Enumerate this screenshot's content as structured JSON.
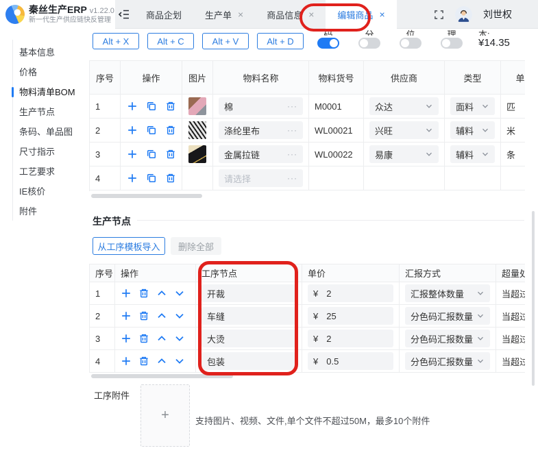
{
  "colors": {
    "accent_blue": "#1f7bf4",
    "annotation_red": "#e0211c"
  },
  "header": {
    "brand": {
      "name": "秦丝生产ERP",
      "version": "v1.22.0",
      "subtitle": "新一代生产供应链快反管理"
    },
    "tabs": [
      {
        "key": "product-planning",
        "label": "商品企划",
        "closable": false,
        "active": false
      },
      {
        "key": "production-order",
        "label": "生产单",
        "closable": true,
        "active": false
      },
      {
        "key": "product-info",
        "label": "商品信息",
        "closable": true,
        "active": false
      },
      {
        "key": "edit-product",
        "label": "编辑商品",
        "closable": true,
        "active": true
      }
    ],
    "user": {
      "name": "刘世权"
    }
  },
  "sidebar": {
    "items": [
      {
        "key": "basic-info",
        "label": "基本信息",
        "active": false
      },
      {
        "key": "price",
        "label": "价格",
        "active": false
      },
      {
        "key": "bom",
        "label": "物料清单BOM",
        "active": true
      },
      {
        "key": "production-node",
        "label": "生产节点",
        "active": false
      },
      {
        "key": "barcode-item-images",
        "label": "条码、单品图",
        "active": false
      },
      {
        "key": "size-guide",
        "label": "尺寸指示",
        "active": false
      },
      {
        "key": "craft-requirements",
        "label": "工艺要求",
        "active": false
      },
      {
        "key": "ie-costing",
        "label": "IE核价",
        "active": false
      },
      {
        "key": "attachments",
        "label": "附件",
        "active": false
      }
    ]
  },
  "shortcuts": {
    "buttons": [
      "Alt + X",
      "Alt + C",
      "Alt + V",
      "Alt + D"
    ]
  },
  "toggles": {
    "items": [
      {
        "clipped_label": "码",
        "on": true
      },
      {
        "clipped_label": "分",
        "on": false
      },
      {
        "clipped_label": "位",
        "on": false
      },
      {
        "clipped_label": "理",
        "on": false
      }
    ],
    "cost": {
      "clipped_label": "本:",
      "value": "¥14.35"
    }
  },
  "bom_table": {
    "headers": [
      "序号",
      "操作",
      "图片",
      "物料名称",
      "物料货号",
      "供应商",
      "类型",
      "单位"
    ],
    "action_icons": [
      "add",
      "copy",
      "delete"
    ],
    "rows": [
      {
        "no": "1",
        "image": "cotton",
        "name": "棉",
        "code": "M0001",
        "supplier": "众达",
        "type": "面料",
        "unit": "匹"
      },
      {
        "no": "2",
        "image": "stripe-fabric",
        "name": "涤纶里布",
        "code": "WL00021",
        "supplier": "兴旺",
        "type": "辅料",
        "unit": "米"
      },
      {
        "no": "3",
        "image": "zipper",
        "name": "金属拉链",
        "code": "WL00022",
        "supplier": "易康",
        "type": "辅料",
        "unit": "条"
      },
      {
        "no": "4",
        "image": null,
        "name": "",
        "name_placeholder": "请选择",
        "code": "",
        "supplier": null,
        "type": null,
        "unit": ""
      }
    ]
  },
  "production_section": {
    "title": "生产节点",
    "buttons": {
      "import": "从工序模板导入",
      "delete_all": "删除全部"
    },
    "table": {
      "headers": [
        "序号",
        "操作",
        "工序节点",
        "单价",
        "汇报方式",
        "超量处理"
      ],
      "action_icons": [
        "add",
        "delete",
        "move-up",
        "move-down"
      ],
      "rows": [
        {
          "no": "1",
          "node": "开裁",
          "currency": "¥",
          "price": "2",
          "report": "汇报整体数量",
          "overage": "当超过"
        },
        {
          "no": "2",
          "node": "车缝",
          "currency": "¥",
          "price": "25",
          "report": "分色码汇报数量",
          "overage": "当超过"
        },
        {
          "no": "3",
          "node": "大烫",
          "currency": "¥",
          "price": "2",
          "report": "分色码汇报数量",
          "overage": "当超过"
        },
        {
          "no": "4",
          "node": "包装",
          "currency": "¥",
          "price": "0.5",
          "report": "分色码汇报数量",
          "overage": "当超过"
        }
      ]
    }
  },
  "process_attachments": {
    "label": "工序附件",
    "plus": "+",
    "hint": "支持图片、视频、文件,单个文件不超过50M，最多10个附件"
  }
}
